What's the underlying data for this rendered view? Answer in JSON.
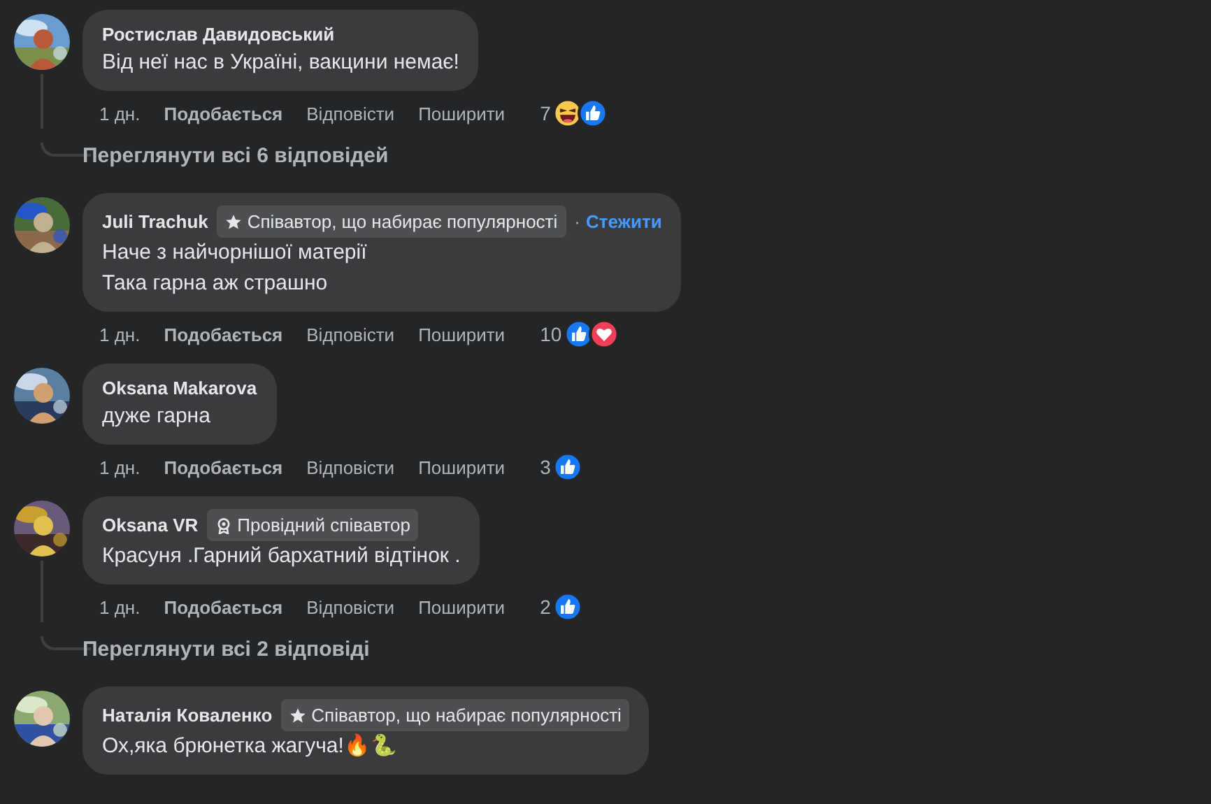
{
  "comments": [
    {
      "author": "Ростислав Давидовський",
      "text": [
        "Від неї нас в Україні, вакцини немає!"
      ],
      "actions": {
        "time": "1 дн.",
        "like": "Подобається",
        "reply": "Відповісти",
        "share": "Поширити"
      },
      "reactions": {
        "count": "7",
        "types": [
          {
            "kind": "haha"
          },
          {
            "kind": "like"
          }
        ]
      },
      "replies_link": "Переглянути всі 6 відповідей"
    },
    {
      "author": "Juli Trachuk",
      "badge": {
        "kind": "rising",
        "label": "Співавтор, що набирає популярності"
      },
      "follow": {
        "separator": "·",
        "label": "Стежити"
      },
      "text": [
        "Наче з найчорнішої матерії",
        "Така гарна аж страшно"
      ],
      "actions": {
        "time": "1 дн.",
        "like": "Подобається",
        "reply": "Відповісти",
        "share": "Поширити"
      },
      "reactions": {
        "count": "10",
        "types": [
          {
            "kind": "like"
          },
          {
            "kind": "love"
          }
        ]
      }
    },
    {
      "author": "Oksana Makarova",
      "text": [
        "дуже гарна"
      ],
      "actions": {
        "time": "1 дн.",
        "like": "Подобається",
        "reply": "Відповісти",
        "share": "Поширити"
      },
      "reactions": {
        "count": "3",
        "types": [
          {
            "kind": "like"
          }
        ]
      }
    },
    {
      "author": "Oksana VR",
      "badge": {
        "kind": "top",
        "label": "Провідний співавтор"
      },
      "text": [
        "Красуня .Гарний бархатний відтінок ."
      ],
      "actions": {
        "time": "1 дн.",
        "like": "Подобається",
        "reply": "Відповісти",
        "share": "Поширити"
      },
      "reactions": {
        "count": "2",
        "types": [
          {
            "kind": "like"
          }
        ]
      },
      "replies_link": "Переглянути всі 2 відповіді"
    },
    {
      "author": "Наталія Коваленко",
      "badge": {
        "kind": "rising",
        "label": "Співавтор, що набирає популярності"
      },
      "text": [
        "Ох,яка брюнетка жагуча!🔥🐍"
      ]
    }
  ]
}
